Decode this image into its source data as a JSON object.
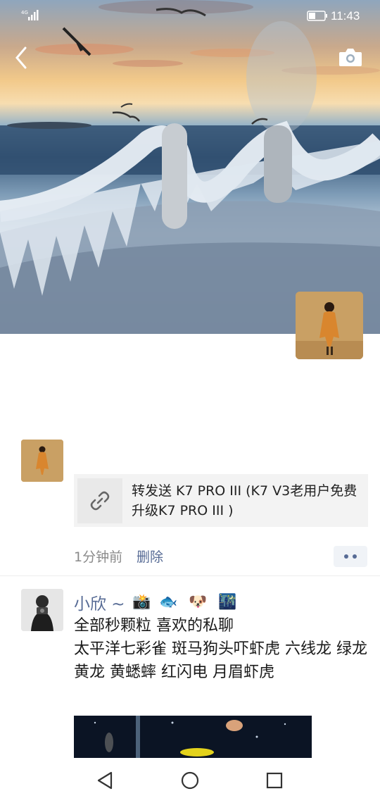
{
  "status_bar": {
    "signal": "4G",
    "time": "11:43"
  },
  "cover": {
    "scene": "frozen rope fence by the sea at sunset with seagulls"
  },
  "post1": {
    "link_title": "转发送 K7 PRO III (K7 V3老用户免费升级K7 PRO III )",
    "time": "1分钟前",
    "delete_label": "删除"
  },
  "post2": {
    "nickname": "小欣 ~",
    "emojis": [
      "📸",
      "🐟",
      "🐶",
      "🌃"
    ],
    "text_lines": [
      "全部秒颗粒 喜欢的私聊",
      "太平洋七彩雀 斑马狗头吓虾虎 六线龙 绿龙 黄龙 黄蟋蟀 红闪电 月眉虾虎"
    ]
  },
  "colors": {
    "link_blue": "#576b95",
    "meta_gray": "#8a8a8a",
    "card_bg": "#f3f3f3"
  }
}
